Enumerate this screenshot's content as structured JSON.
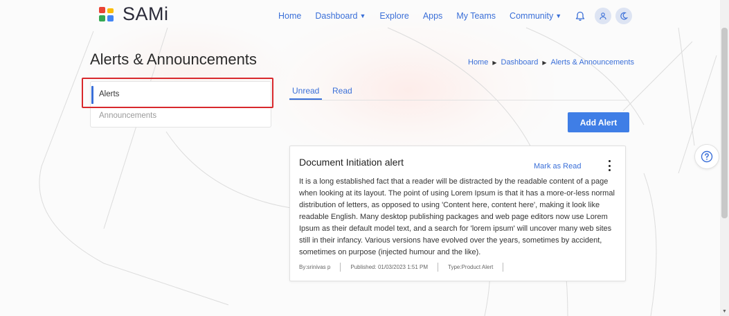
{
  "brand": {
    "name": "SAMi"
  },
  "nav": {
    "home": "Home",
    "dashboard": "Dashboard",
    "explore": "Explore",
    "apps": "Apps",
    "my_teams": "My Teams",
    "community": "Community"
  },
  "page": {
    "title": "Alerts & Announcements"
  },
  "breadcrumb": {
    "items": [
      "Home",
      "Dashboard",
      "Alerts & Announcements"
    ]
  },
  "side_menu": {
    "items": [
      {
        "label": "Alerts",
        "active": true
      },
      {
        "label": "Announcements",
        "active": false
      }
    ]
  },
  "tabs": {
    "items": [
      {
        "label": "Unread",
        "active": true
      },
      {
        "label": "Read",
        "active": false
      }
    ]
  },
  "actions": {
    "add_alert": "Add Alert"
  },
  "alert": {
    "title": "Document Initiation alert",
    "mark_read": "Mark as Read",
    "body": "It is a long established fact that a reader will be distracted by the readable content of a page when looking at its layout. The point of using Lorem Ipsum is that it has a more-or-less normal distribution of letters, as opposed to using 'Content here, content here', making it look like readable English. Many desktop publishing packages and web page editors now use Lorem Ipsum as their default model text, and a search for 'lorem ipsum' will uncover many web sites still in their infancy. Various versions have evolved over the years, sometimes by accident, sometimes on purpose (injected humour and the like).",
    "by": "By:srinivas p",
    "published": "Published: 01/03/2023 1:51 PM",
    "type": "Type:Product Alert"
  },
  "colors": {
    "accent": "#3a6fd8",
    "button": "#3f7ee6",
    "highlight": "#d8282c"
  },
  "icons": {
    "logo": "sami-logo-icon",
    "bell": "bell-icon",
    "user": "user-icon",
    "theme": "moon-icon",
    "help": "help-icon",
    "kebab": "more-vertical-icon"
  }
}
